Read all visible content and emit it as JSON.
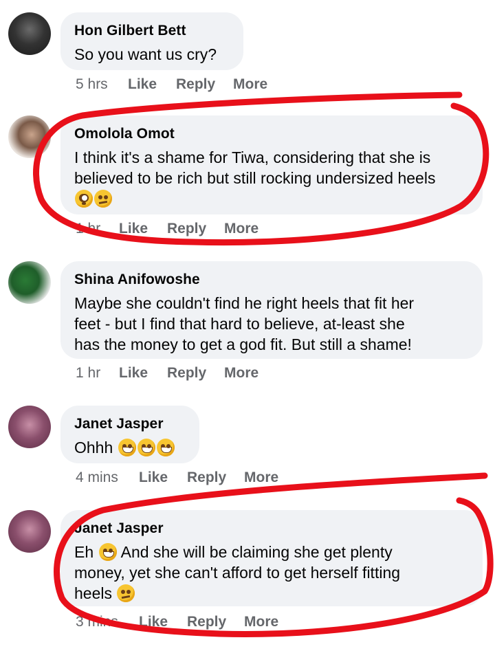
{
  "comments": [
    {
      "author": "Hon Gilbert Bett",
      "text": "So you want us cry?",
      "time": "5 hrs",
      "like": "Like",
      "reply": "Reply",
      "more": "More"
    },
    {
      "author": "Omolola Omot",
      "text_line1": "I think it's a shame for Tiwa, considering that she is",
      "text_line2": "believed to be rich but still rocking undersized heels",
      "time": "1 hr",
      "like": "Like",
      "reply": "Reply",
      "more": "More"
    },
    {
      "author": "Shina Anifowoshe",
      "text_line1": "Maybe she couldn't find he right heels that fit her",
      "text_line2": "feet - but I find that hard to believe, at-least she",
      "text_line3": "has the money to get a god fit. But still a shame!",
      "time": "1 hr",
      "like": "Like",
      "reply": "Reply",
      "more": "More"
    },
    {
      "author": "Janet Jasper",
      "text": "Ohhh",
      "time": "4 mins",
      "like": "Like",
      "reply": "Reply",
      "more": "More"
    },
    {
      "author": "Janet Jasper",
      "text_line1_a": "Eh",
      "text_line1_b": "And she will be claiming she get plenty",
      "text_line2": "money, yet she can't afford to get herself fitting",
      "text_line3": "heels",
      "time": "3 mins",
      "like": "Like",
      "reply": "Reply",
      "more": "More"
    }
  ],
  "colors": {
    "bubble": "#f0f2f5",
    "meta": "#65676b",
    "annotation": "#e8101a"
  },
  "icons": [
    "grinning-sweat-emoji",
    "flushed-face-emoji",
    "thinking-face-emoji"
  ]
}
